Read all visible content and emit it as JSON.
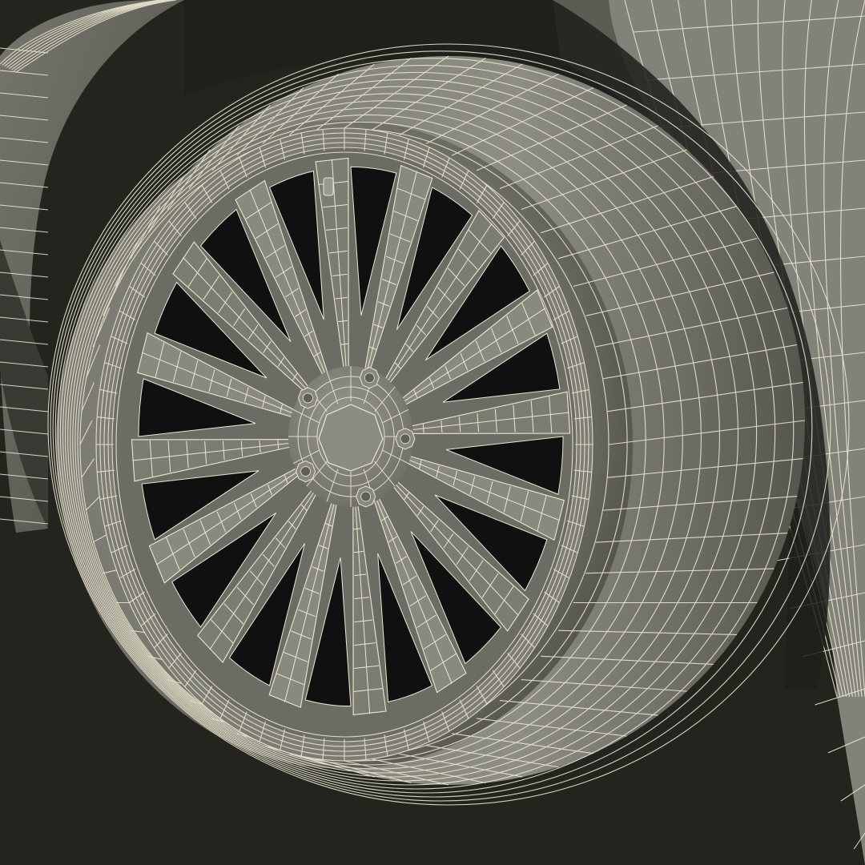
{
  "scene": {
    "subject": "wireframe-wheel-render",
    "colors": {
      "background": "#24241f",
      "surface_light": "#8d8c82",
      "surface_mid": "#6f6e65",
      "surface_dark": "#45443e",
      "wire": "#ece7d2",
      "cavity": "#101010",
      "lug": "#8a897f"
    },
    "wheel": {
      "spoke_count": 16,
      "lug_nut_count": 5,
      "has_valve_stem": true
    }
  }
}
